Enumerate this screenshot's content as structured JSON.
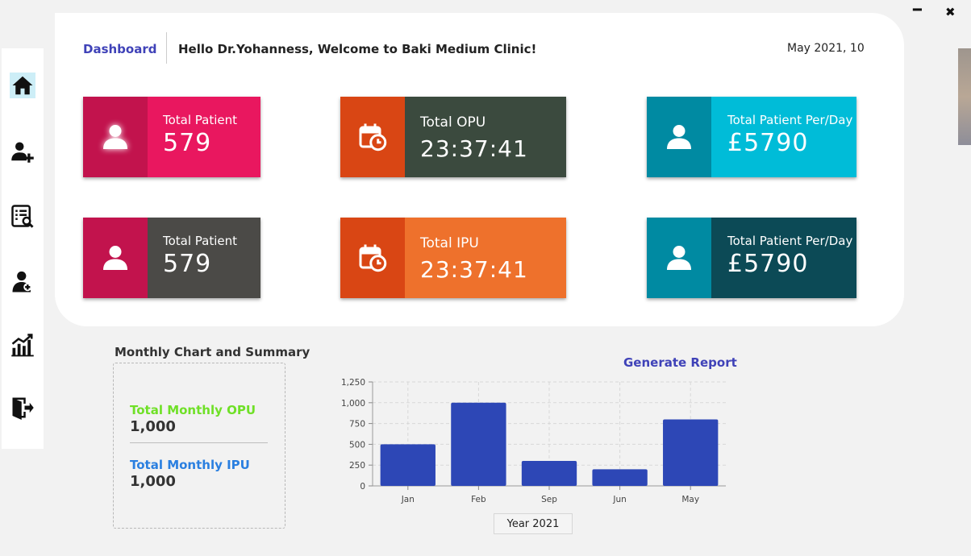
{
  "window": {
    "minimize": "━",
    "close": "✖"
  },
  "sidebar": {
    "items": [
      {
        "name": "home",
        "icon": "home-icon"
      },
      {
        "name": "add-patient",
        "icon": "user-plus-icon"
      },
      {
        "name": "search-records",
        "icon": "search-list-icon"
      },
      {
        "name": "doctor",
        "icon": "doctor-icon"
      },
      {
        "name": "analytics",
        "icon": "bar-chart-icon"
      },
      {
        "name": "logout",
        "icon": "logout-icon"
      }
    ]
  },
  "header": {
    "breadcrumb": "Dashboard",
    "welcome": "Hello Dr.Yohanness, Welcome to Baki Medium Clinic!",
    "date": "May 2021, 10"
  },
  "cards": [
    {
      "label": "Total Patient",
      "value": "579",
      "icon": "user-icon",
      "icon_bg": "#c2134d",
      "body_bg": "#e9175f"
    },
    {
      "label": "Total OPU",
      "value": "23:37:41",
      "icon": "calendar-clock-icon",
      "icon_bg": "#d94614",
      "body_bg": "#3b4a3e"
    },
    {
      "label": "Total Patient Per/Day",
      "value": "£5790",
      "icon": "user-icon",
      "icon_bg": "#008aa2",
      "body_bg": "#00bcd8"
    },
    {
      "label": "Total Patient",
      "value": "579",
      "icon": "user-icon",
      "icon_bg": "#c2134d",
      "body_bg": "#4b4a47"
    },
    {
      "label": "Total IPU",
      "value": "23:37:41",
      "icon": "calendar-clock-icon",
      "icon_bg": "#d94614",
      "body_bg": "#ee712c"
    },
    {
      "label": "Total Patient Per/Day",
      "value": "£5790",
      "icon": "user-icon",
      "icon_bg": "#008aa2",
      "body_bg": "#0c4a56"
    }
  ],
  "summary": {
    "title": "Monthly Chart and Summary",
    "opu_label": "Total Monthly OPU",
    "opu_value": "1,000",
    "ipu_label": "Total Monthly IPU",
    "ipu_value": "1,000"
  },
  "generate_report": "Generate Report",
  "year_selector": "Year 2021",
  "chart_data": {
    "type": "bar",
    "categories": [
      "Jan",
      "Feb",
      "Sep",
      "Jun",
      "May"
    ],
    "values": [
      500,
      1000,
      300,
      200,
      800
    ],
    "ylim": [
      0,
      1250
    ],
    "yticks": [
      "0",
      "250",
      "500",
      "750",
      "1,000",
      "1,250"
    ],
    "grid": true,
    "bar_color": "#2d47b6"
  }
}
